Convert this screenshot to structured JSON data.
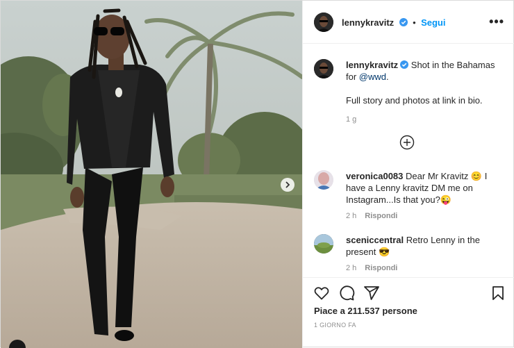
{
  "post": {
    "author": "lennykravitz",
    "follow_label": "Segui",
    "more_label": "•••",
    "caption": {
      "username": "lennykravitz",
      "text_before_mention": "Shot in the Bahamas for ",
      "mention": "@wwd",
      "text_after_mention": ".",
      "line2": "Full story and photos at link in bio.",
      "time": "1 g"
    },
    "comments": [
      {
        "username": "veronica0083",
        "text": "Dear Mr Kravitz 😊 I have a Lenny kravitz DM me on Instagram...Is that you?😜",
        "time": "2 h",
        "reply_label": "Rispondi"
      },
      {
        "username": "sceniccentral",
        "text": "Retro Lenny in the present 😎",
        "time": "2 h",
        "reply_label": "Rispondi"
      }
    ],
    "likes_label": "Piace a 211.537 persone",
    "date_label": "1 GIORNO FA"
  },
  "colors": {
    "link": "#0095f6",
    "mention": "#00376b",
    "muted": "#8e8e8e",
    "verified": "#3897f0"
  },
  "icons": [
    "verified-badge-icon",
    "more-options-icon",
    "add-comment-circle-icon",
    "heart-icon",
    "comment-icon",
    "share-icon",
    "bookmark-icon",
    "chevron-right-icon"
  ]
}
